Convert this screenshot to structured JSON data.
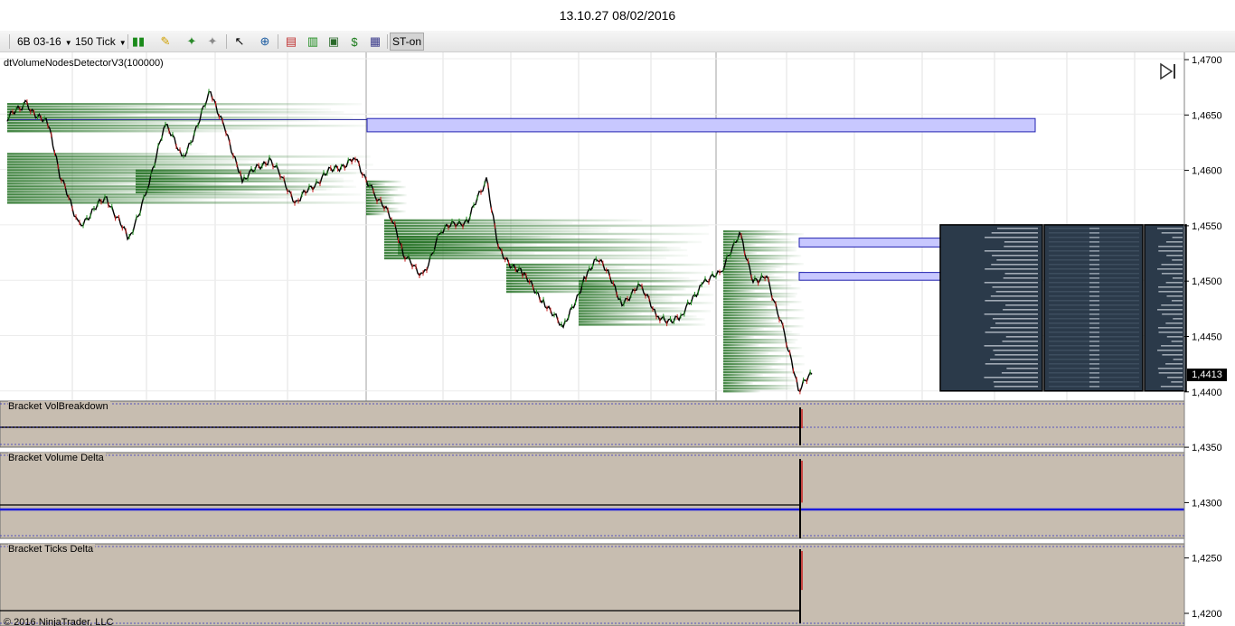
{
  "window": {
    "title": "13.10.27 08/02/2016"
  },
  "toolbar": {
    "instrument": "6B 03-16",
    "interval": "150 Tick",
    "strategy_button": "ST-on",
    "icons": [
      "bar-style-icon",
      "pencil-icon",
      "pin-add-icon",
      "pin-remove-icon",
      "cursor-icon",
      "zoom-icon",
      "strategy-icon",
      "chart-icon",
      "sparkline-icon",
      "dollar-icon",
      "properties-icon"
    ]
  },
  "indicator_label": "dtVolumeNodesDetectorV3(100000)",
  "panels": [
    {
      "label": "Bracket VolBreakdown"
    },
    {
      "label": "Bracket Volume Delta"
    },
    {
      "label": "Bracket Ticks Delta"
    }
  ],
  "price_axis": {
    "ticks": [
      "1,4700",
      "1,4650",
      "1,4600",
      "1,4550",
      "1,4500",
      "1,4450",
      "1,4400",
      "1,4350",
      "1,4300",
      "1,4250",
      "1,4200"
    ],
    "current_price": "1,4413"
  },
  "copyright": "© 2016 NinjaTrader, LLC",
  "colors": {
    "candle_up": "#1e8f1e",
    "candle_down": "#c81e1e",
    "volume_node": "#1f6e1f",
    "zone_fill": "#c8c8ff",
    "zone_border": "#2020b0",
    "panel_bg": "#c7bdb0",
    "profile_bg": "#2b3a4a",
    "delta_line": "#1a1adc"
  },
  "chart_data": {
    "type": "line",
    "x_axis": "150 tick bars",
    "price_path": [
      [
        0,
        1.4645
      ],
      [
        20,
        1.466
      ],
      [
        45,
        1.464
      ],
      [
        60,
        1.459
      ],
      [
        80,
        1.455
      ],
      [
        110,
        1.4575
      ],
      [
        135,
        1.4535
      ],
      [
        155,
        1.4585
      ],
      [
        175,
        1.464
      ],
      [
        195,
        1.461
      ],
      [
        225,
        1.467
      ],
      [
        240,
        1.464
      ],
      [
        260,
        1.459
      ],
      [
        290,
        1.461
      ],
      [
        320,
        1.457
      ],
      [
        350,
        1.4595
      ],
      [
        385,
        1.461
      ],
      [
        405,
        1.458
      ],
      [
        425,
        1.4555
      ],
      [
        440,
        1.452
      ],
      [
        460,
        1.4505
      ],
      [
        480,
        1.4545
      ],
      [
        510,
        1.4555
      ],
      [
        530,
        1.459
      ],
      [
        545,
        1.4525
      ],
      [
        570,
        1.4505
      ],
      [
        595,
        1.448
      ],
      [
        615,
        1.4455
      ],
      [
        640,
        1.4505
      ],
      [
        655,
        1.452
      ],
      [
        680,
        1.448
      ],
      [
        700,
        1.4495
      ],
      [
        720,
        1.4465
      ],
      [
        745,
        1.4465
      ],
      [
        770,
        1.45
      ],
      [
        790,
        1.4505
      ],
      [
        810,
        1.4545
      ],
      [
        825,
        1.45
      ],
      [
        840,
        1.4505
      ],
      [
        860,
        1.445
      ],
      [
        875,
        1.44
      ],
      [
        890,
        1.4415
      ]
    ],
    "zones": [
      {
        "from": 1.4646,
        "to": 1.4634,
        "label": "zone-1"
      },
      {
        "from": 1.4538,
        "to": 1.453,
        "label": "zone-2"
      },
      {
        "from": 1.4507,
        "to": 1.45,
        "label": "zone-3"
      }
    ],
    "volume_profile": {
      "price_range": [
        1.44,
        1.455
      ]
    },
    "ylim": [
      1.44,
      1.47
    ]
  }
}
